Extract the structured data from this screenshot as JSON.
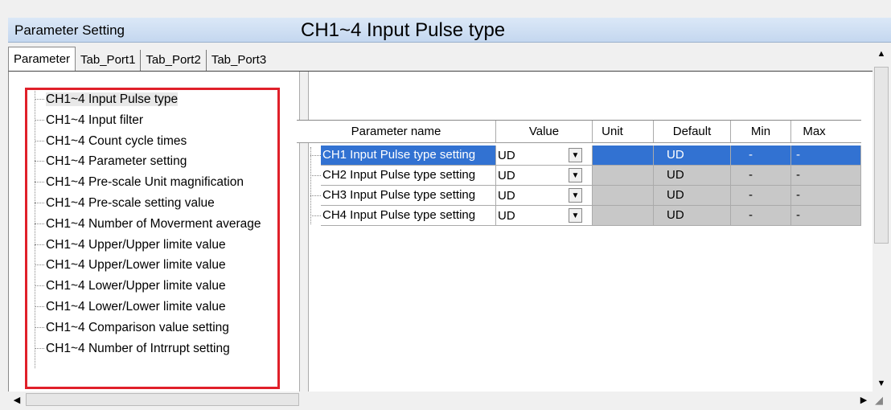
{
  "window": {
    "title": "Parameter Setting"
  },
  "tabs": [
    {
      "label": "Parameter",
      "active": true
    },
    {
      "label": "Tab_Port1",
      "active": false
    },
    {
      "label": "Tab_Port2",
      "active": false
    },
    {
      "label": "Tab_Port3",
      "active": false
    }
  ],
  "tree": {
    "items": [
      "CH1~4 Input Pulse type",
      "CH1~4 Input filter",
      "CH1~4 Count cycle times",
      "CH1~4 Parameter setting",
      "CH1~4 Pre-scale Unit magnification",
      "CH1~4 Pre-scale setting value",
      "CH1~4 Number of Moverment average",
      "CH1~4 Upper/Upper limite value",
      "CH1~4 Upper/Lower limite value",
      "CH1~4 Lower/Upper limite value",
      "CH1~4 Lower/Lower limite value",
      "CH1~4 Comparison value setting",
      "CH1~4 Number of Intrrupt setting"
    ],
    "selected_index": 0
  },
  "section": {
    "title": "CH1~4 Input Pulse type"
  },
  "grid": {
    "headers": {
      "name": "Parameter name",
      "value": "Value",
      "unit": "Unit",
      "default": "Default",
      "min": "Min",
      "max": "Max"
    },
    "rows": [
      {
        "name": "CH1 Input Pulse type setting",
        "value": "UD",
        "unit": "",
        "default": "UD",
        "min": "-",
        "max": "-"
      },
      {
        "name": "CH2 Input Pulse type setting",
        "value": "UD",
        "unit": "",
        "default": "UD",
        "min": "-",
        "max": "-"
      },
      {
        "name": "CH3 Input Pulse type setting",
        "value": "UD",
        "unit": "",
        "default": "UD",
        "min": "-",
        "max": "-"
      },
      {
        "name": "CH4 Input Pulse type setting",
        "value": "UD",
        "unit": "",
        "default": "UD",
        "min": "-",
        "max": "-"
      }
    ],
    "selected_row": 0
  },
  "icons": {
    "dropdown": "▼",
    "scroll_up": "▲",
    "scroll_down": "▼",
    "scroll_left": "◀",
    "scroll_right": "▶",
    "grip": "◢"
  },
  "colors": {
    "selection": "#3272d2",
    "highlight_border": "#e0202a",
    "readonly_cell": "#c8c8c8",
    "titlebar": "#c4d7ef"
  }
}
